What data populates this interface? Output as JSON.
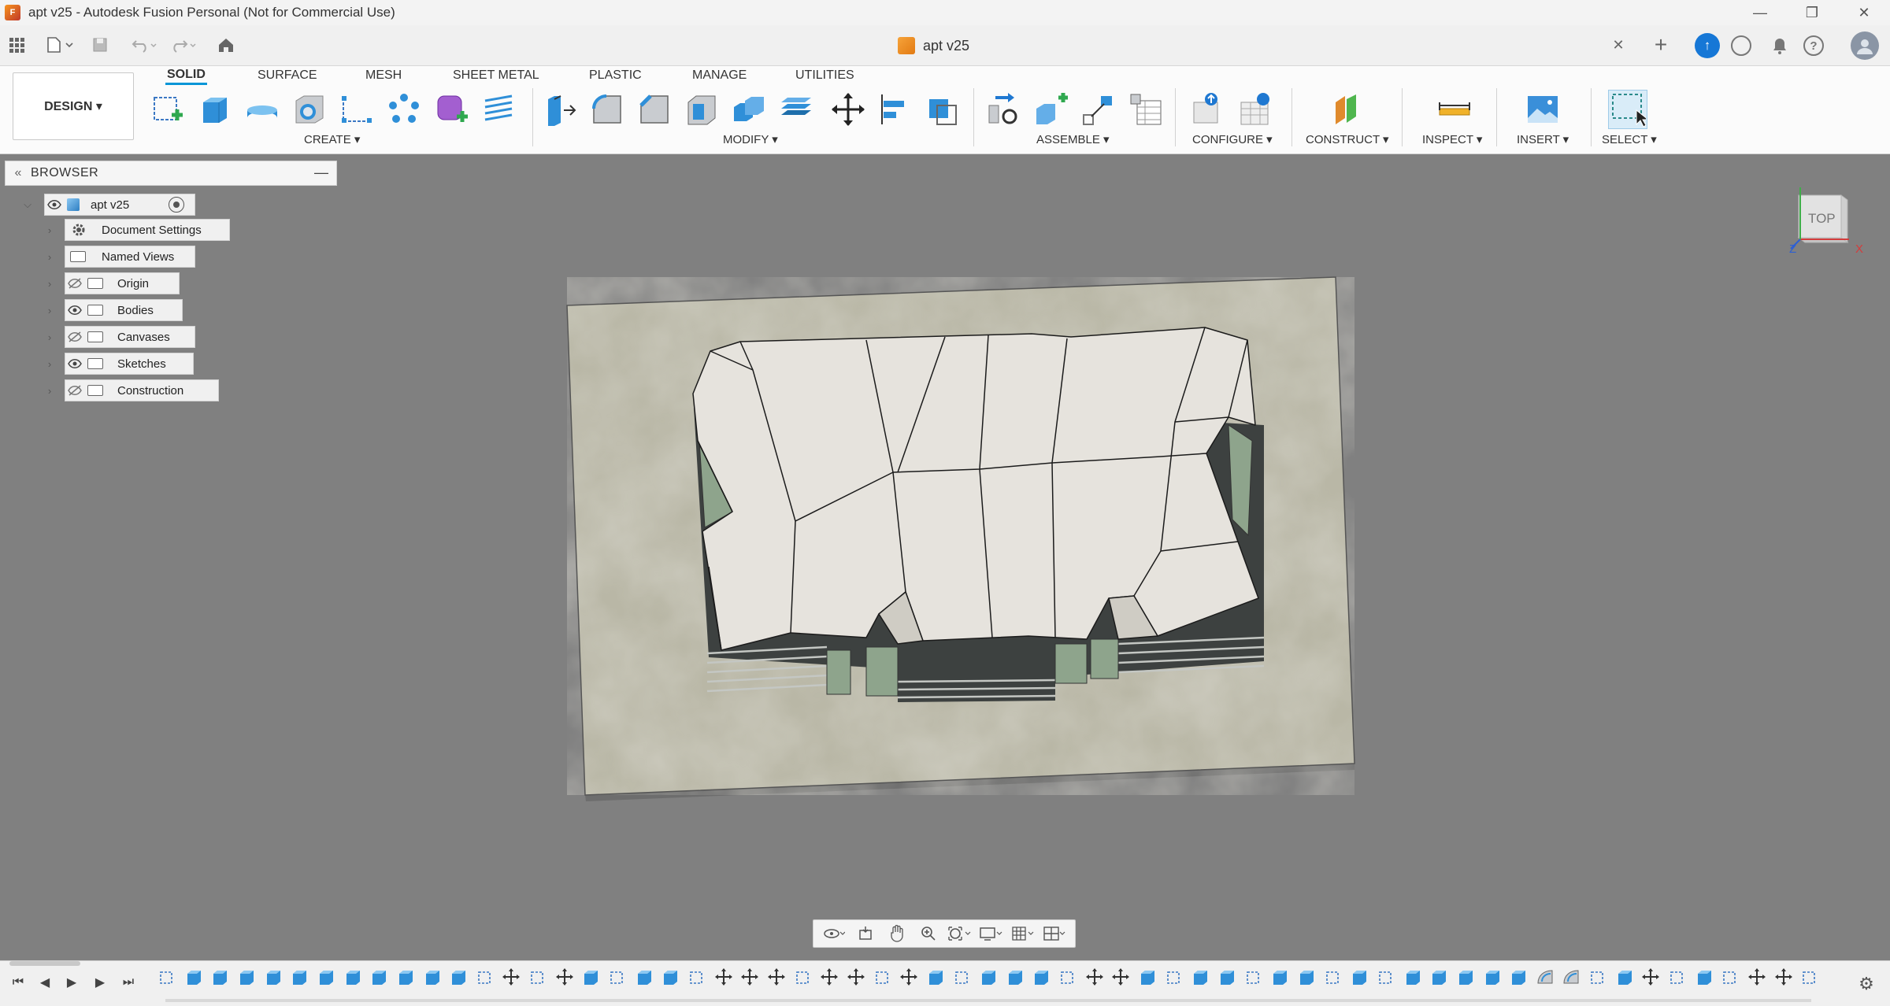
{
  "window": {
    "title": "apt v25 - Autodesk Fusion Personal (Not for Commercial Use)",
    "minimize": "—",
    "restore": "❐",
    "close": "✕"
  },
  "tabbar": {
    "document_tab": "apt v25",
    "close_tab": "✕",
    "new_tab": "+"
  },
  "ribbon": {
    "workspace": "DESIGN ▾",
    "tabs": [
      "SOLID",
      "SURFACE",
      "MESH",
      "SHEET METAL",
      "PLASTIC",
      "MANAGE",
      "UTILITIES"
    ],
    "groups": [
      "CREATE ▾",
      "MODIFY ▾",
      "ASSEMBLE ▾",
      "CONFIGURE ▾",
      "CONSTRUCT ▾",
      "INSPECT ▾",
      "INSERT ▾",
      "SELECT ▾"
    ],
    "accent": "#0696d7"
  },
  "browser": {
    "title": "BROWSER",
    "root": "apt v25",
    "items": [
      {
        "label": "Document Settings",
        "icon": "gear-icon",
        "eye": ""
      },
      {
        "label": "Named Views",
        "icon": "folder-icon",
        "eye": ""
      },
      {
        "label": "Origin",
        "icon": "folder-icon",
        "eye": "hidden"
      },
      {
        "label": "Bodies",
        "icon": "folder-icon",
        "eye": "visible"
      },
      {
        "label": "Canvases",
        "icon": "folder-icon",
        "eye": "hidden"
      },
      {
        "label": "Sketches",
        "icon": "folder-icon",
        "eye": "visible"
      },
      {
        "label": "Construction",
        "icon": "folder-icon",
        "eye": "hidden"
      }
    ]
  },
  "viewcube": {
    "face": "TOP",
    "axis_x": "X",
    "axis_y": "Y",
    "axis_z": "Z"
  },
  "colors": {
    "viewport": "#808080",
    "roof": "#e6e3dd",
    "site": "#b9b7a6"
  }
}
